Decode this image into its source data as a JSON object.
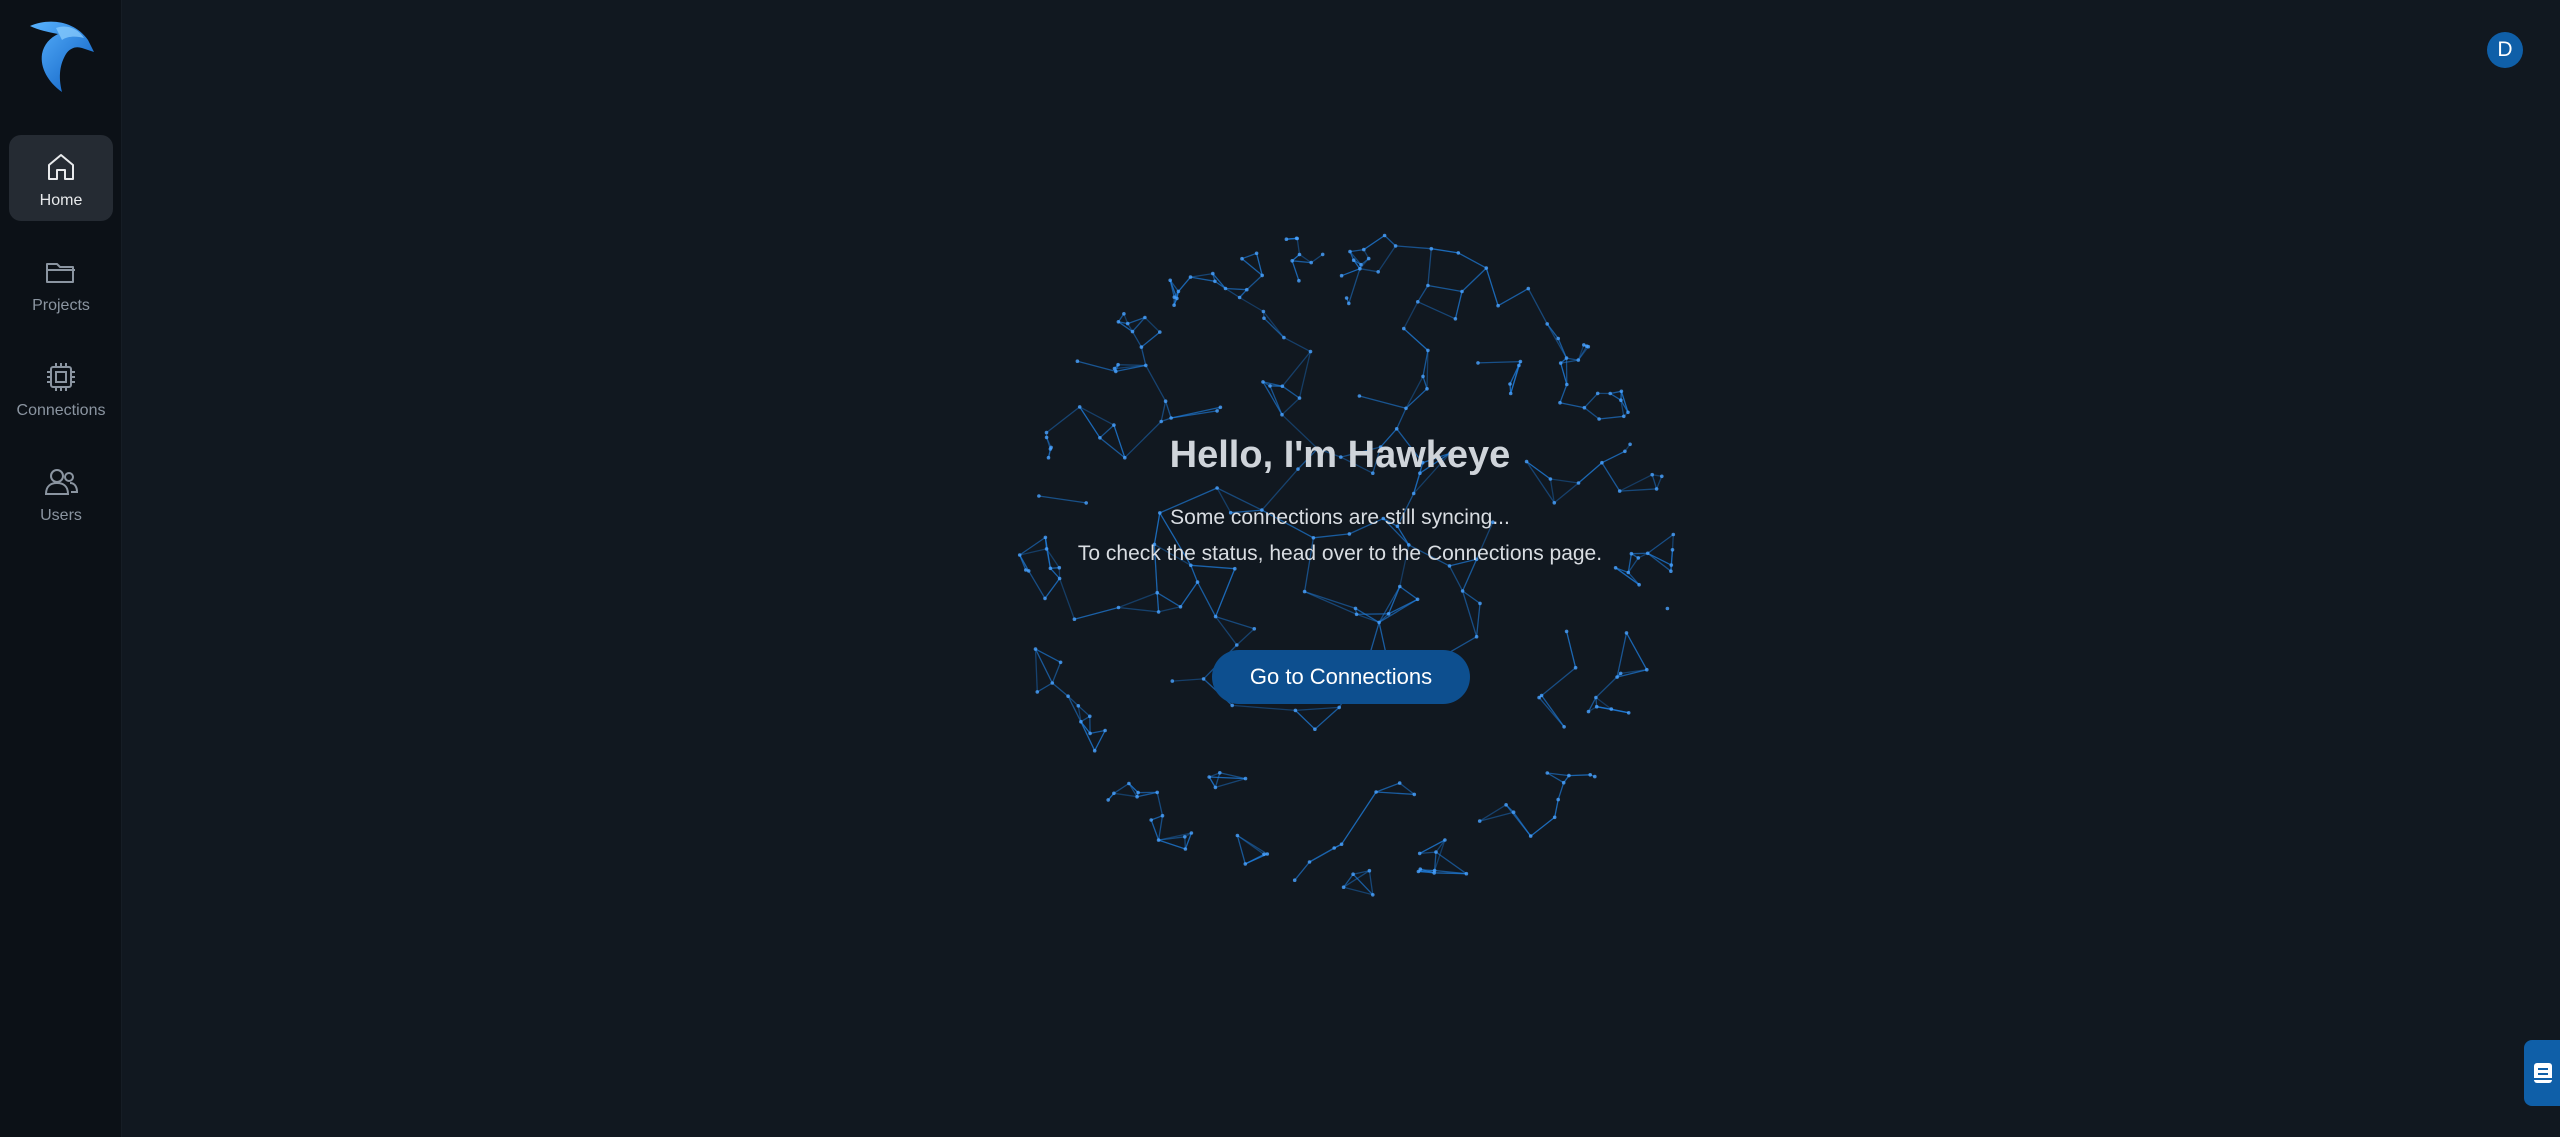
{
  "sidebar": {
    "logo_icon": "eagle-logo-icon",
    "items": [
      {
        "label": "Home",
        "icon": "home-icon",
        "active": true
      },
      {
        "label": "Projects",
        "icon": "folder-icon",
        "active": false
      },
      {
        "label": "Connections",
        "icon": "chip-icon",
        "active": false
      },
      {
        "label": "Users",
        "icon": "users-icon",
        "active": false
      }
    ]
  },
  "header": {
    "avatar_initial": "D"
  },
  "main": {
    "title": "Hello, I'm Hawkeye",
    "line1": "Some connections are still syncing...",
    "line2": "To check the status, head over to the Connections page.",
    "cta_label": "Go to Connections"
  },
  "colors": {
    "background": "#111820",
    "sidebar": "#0c1117",
    "accent": "#0f5fa8",
    "button": "#0d4f8f",
    "globe": "#1f7fe0"
  },
  "chat_tab_icon": "chat-book-icon"
}
